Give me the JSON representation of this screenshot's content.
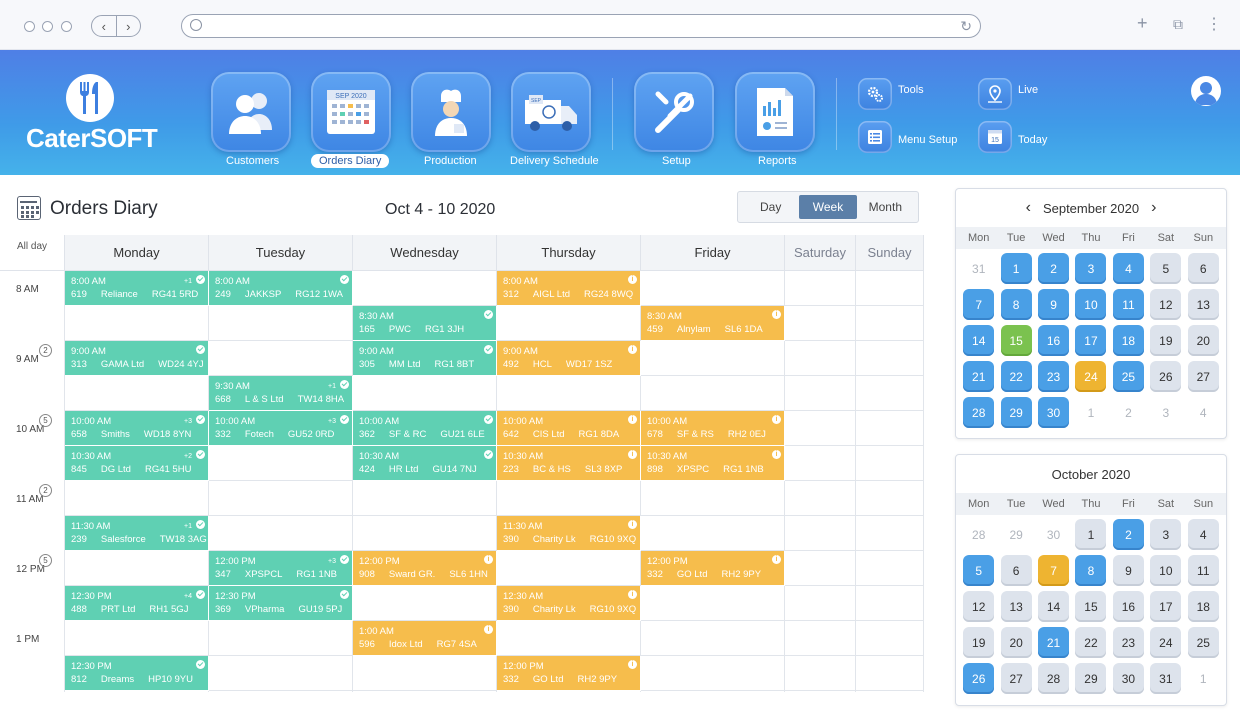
{
  "header": {
    "brand": "CaterSOFT",
    "nav": [
      {
        "label": "Customers",
        "icon": "customers-icon"
      },
      {
        "label": "Orders Diary",
        "icon": "calendar-icon",
        "icon_text": "SEP 2020",
        "active": true
      },
      {
        "label": "Production",
        "icon": "chef-icon"
      },
      {
        "label": "Delivery Schedule",
        "icon": "delivery-van-icon",
        "icon_text": "SEP"
      },
      {
        "label": "Setup",
        "icon": "tools-icon"
      },
      {
        "label": "Reports",
        "icon": "report-icon"
      }
    ],
    "quick": [
      {
        "label": "Tools",
        "icon": "gear-icon"
      },
      {
        "label": "Live",
        "icon": "map-pin-icon"
      },
      {
        "label": "Menu Setup",
        "icon": "list-icon"
      },
      {
        "label": "Today",
        "icon": "today-icon",
        "icon_text": "15"
      }
    ]
  },
  "toolbar": {
    "title": "Orders Diary",
    "range": "Oct 4 -  10 2020",
    "views": [
      "Day",
      "Week",
      "Month"
    ],
    "active_view": "Week"
  },
  "grid": {
    "allday": "All day",
    "days": [
      "Monday",
      "Tuesday",
      "Wednesday",
      "Thursday",
      "Friday",
      "Saturday",
      "Sunday"
    ],
    "times": [
      {
        "label": "8 AM",
        "row": 0
      },
      {
        "label": "9 AM",
        "row": 2,
        "count": "2"
      },
      {
        "label": "10 AM",
        "row": 4,
        "count": "5"
      },
      {
        "label": "11 AM",
        "row": 6,
        "count": "2"
      },
      {
        "label": "12 PM",
        "row": 8,
        "count": "5"
      },
      {
        "label": "1 PM",
        "row": 10
      }
    ],
    "events": [
      {
        "day": 0,
        "row": 0,
        "color": "green",
        "time": "8:00 AM",
        "id": "619",
        "name": "Reliance",
        "code": "RG41 5RD",
        "extra": "+1"
      },
      {
        "day": 1,
        "row": 0,
        "color": "green",
        "time": "8:00 AM",
        "id": "249",
        "name": "JAKKSP",
        "code": "RG12 1WA"
      },
      {
        "day": 3,
        "row": 0,
        "color": "orange",
        "time": "8:00 AM",
        "id": "312",
        "name": "AIGL Ltd",
        "code": "RG24 8WQ"
      },
      {
        "day": 2,
        "row": 1,
        "color": "green",
        "time": "8:30 AM",
        "id": "165",
        "name": "PWC",
        "code": "RG1 3JH"
      },
      {
        "day": 4,
        "row": 1,
        "color": "orange",
        "time": "8:30 AM",
        "id": "459",
        "name": "Alnylam",
        "code": "SL6 1DA"
      },
      {
        "day": 0,
        "row": 2,
        "color": "green",
        "time": "9:00 AM",
        "id": "313",
        "name": "GAMA Ltd",
        "code": "WD24 4YJ"
      },
      {
        "day": 2,
        "row": 2,
        "color": "green",
        "time": "9:00 AM",
        "id": "305",
        "name": "MM Ltd",
        "code": "RG1 8BT"
      },
      {
        "day": 3,
        "row": 2,
        "color": "orange",
        "time": "9:00 AM",
        "id": "492",
        "name": "HCL",
        "code": "WD17 1SZ"
      },
      {
        "day": 1,
        "row": 3,
        "color": "green",
        "time": "9:30 AM",
        "id": "668",
        "name": "L & S Ltd",
        "code": "TW14 8HA",
        "extra": "+1"
      },
      {
        "day": 0,
        "row": 4,
        "color": "green",
        "time": "10:00 AM",
        "id": "658",
        "name": "Smiths",
        "code": "WD18 8YN",
        "extra": "+3"
      },
      {
        "day": 1,
        "row": 4,
        "color": "green",
        "time": "10:00 AM",
        "id": "332",
        "name": "Fotech",
        "code": "GU52 0RD",
        "extra": "+3"
      },
      {
        "day": 2,
        "row": 4,
        "color": "green",
        "time": "10:00 AM",
        "id": "362",
        "name": "SF & RC",
        "code": "GU21 6LE"
      },
      {
        "day": 3,
        "row": 4,
        "color": "orange",
        "time": "10:00 AM",
        "id": "642",
        "name": "CIS Ltd",
        "code": "RG1 8DA"
      },
      {
        "day": 4,
        "row": 4,
        "color": "orange",
        "time": "10:00 AM",
        "id": "678",
        "name": "SF & RS",
        "code": "RH2 0EJ"
      },
      {
        "day": 0,
        "row": 5,
        "color": "green",
        "time": "10:30 AM",
        "id": "845",
        "name": "DG Ltd",
        "code": "RG41 5HU",
        "extra": "+2"
      },
      {
        "day": 2,
        "row": 5,
        "color": "green",
        "time": "10:30 AM",
        "id": "424",
        "name": "HR Ltd",
        "code": "GU14 7NJ"
      },
      {
        "day": 3,
        "row": 5,
        "color": "orange",
        "time": "10:30 AM",
        "id": "223",
        "name": "BC & HS",
        "code": "SL3 8XP"
      },
      {
        "day": 4,
        "row": 5,
        "color": "orange",
        "time": "10:30 AM",
        "id": "898",
        "name": "XPSPC",
        "code": "RG1 1NB"
      },
      {
        "day": 0,
        "row": 7,
        "color": "green",
        "time": "11:30 AM",
        "id": "239",
        "name": "Salesforce",
        "code": "TW18 3AG",
        "extra": "+1"
      },
      {
        "day": 3,
        "row": 7,
        "color": "orange",
        "time": "11:30 AM",
        "id": "390",
        "name": "Charity Lk",
        "code": "RG10 9XQ"
      },
      {
        "day": 1,
        "row": 8,
        "color": "green",
        "time": "12:00 PM",
        "id": "347",
        "name": "XPSPCL",
        "code": "RG1 1NB",
        "extra": "+3"
      },
      {
        "day": 2,
        "row": 8,
        "color": "orange",
        "time": "12:00 PM",
        "id": "908",
        "name": "Sward GR.",
        "code": "SL6 1HN"
      },
      {
        "day": 4,
        "row": 8,
        "color": "orange",
        "time": "12:00 PM",
        "id": "332",
        "name": "GO Ltd",
        "code": "RH2 9PY"
      },
      {
        "day": 0,
        "row": 9,
        "color": "green",
        "time": "12:30 PM",
        "id": "488",
        "name": "PRT Ltd",
        "code": "RH1 5GJ",
        "extra": "+4"
      },
      {
        "day": 1,
        "row": 9,
        "color": "green",
        "time": "12:30 PM",
        "id": "369",
        "name": "VPharma",
        "code": "GU19 5PJ"
      },
      {
        "day": 3,
        "row": 9,
        "color": "orange",
        "time": "12:30 AM",
        "id": "390",
        "name": "Charity Lk",
        "code": "RG10 9XQ"
      },
      {
        "day": 2,
        "row": 10,
        "color": "orange",
        "time": "1:00 AM",
        "id": "596",
        "name": "Idox Ltd",
        "code": "RG7 4SA"
      },
      {
        "day": 0,
        "row": 11,
        "color": "green",
        "time": "12:30 PM",
        "id": "812",
        "name": "Dreams",
        "code": "HP10 9YU"
      },
      {
        "day": 3,
        "row": 11,
        "color": "orange",
        "time": "12:00 PM",
        "id": "332",
        "name": "GO Ltd",
        "code": "RH2 9PY"
      }
    ]
  },
  "calendars": [
    {
      "title": "September 2020",
      "nav": true,
      "dow": [
        "Mon",
        "Tue",
        "Wed",
        "Thu",
        "Fri",
        "Sat",
        "Sun"
      ],
      "days": [
        [
          "31",
          "m"
        ],
        [
          "1",
          "b"
        ],
        [
          "2",
          "b"
        ],
        [
          "3",
          "b"
        ],
        [
          "4",
          "b"
        ],
        [
          "5",
          "n"
        ],
        [
          "6",
          "n"
        ],
        [
          "7",
          "b"
        ],
        [
          "8",
          "b"
        ],
        [
          "9",
          "b"
        ],
        [
          "10",
          "b"
        ],
        [
          "11",
          "b"
        ],
        [
          "12",
          "n"
        ],
        [
          "13",
          "n"
        ],
        [
          "14",
          "b"
        ],
        [
          "15",
          "gr"
        ],
        [
          "16",
          "b"
        ],
        [
          "17",
          "b"
        ],
        [
          "18",
          "b"
        ],
        [
          "19",
          "n"
        ],
        [
          "20",
          "n"
        ],
        [
          "21",
          "b"
        ],
        [
          "22",
          "b"
        ],
        [
          "23",
          "b"
        ],
        [
          "24",
          "yl"
        ],
        [
          "25",
          "b"
        ],
        [
          "26",
          "n"
        ],
        [
          "27",
          "n"
        ],
        [
          "28",
          "b"
        ],
        [
          "29",
          "b"
        ],
        [
          "30",
          "b"
        ],
        [
          "1",
          "m"
        ],
        [
          "2",
          "m"
        ],
        [
          "3",
          "m"
        ],
        [
          "4",
          "m"
        ]
      ]
    },
    {
      "title": "October 2020",
      "nav": false,
      "dow": [
        "Mon",
        "Tue",
        "Wed",
        "Thu",
        "Fri",
        "Sat",
        "Sun"
      ],
      "days": [
        [
          "28",
          "m"
        ],
        [
          "29",
          "m"
        ],
        [
          "30",
          "m"
        ],
        [
          "1",
          "n"
        ],
        [
          "2",
          "b"
        ],
        [
          "3",
          "n"
        ],
        [
          "4",
          "n"
        ],
        [
          "5",
          "b"
        ],
        [
          "6",
          "n"
        ],
        [
          "7",
          "yl"
        ],
        [
          "8",
          "b"
        ],
        [
          "9",
          "n"
        ],
        [
          "10",
          "n"
        ],
        [
          "11",
          "n"
        ],
        [
          "12",
          "n"
        ],
        [
          "13",
          "n"
        ],
        [
          "14",
          "n"
        ],
        [
          "15",
          "n"
        ],
        [
          "16",
          "n"
        ],
        [
          "17",
          "n"
        ],
        [
          "18",
          "n"
        ],
        [
          "19",
          "n"
        ],
        [
          "20",
          "n"
        ],
        [
          "21",
          "b"
        ],
        [
          "22",
          "n"
        ],
        [
          "23",
          "n"
        ],
        [
          "24",
          "n"
        ],
        [
          "25",
          "n"
        ],
        [
          "26",
          "b"
        ],
        [
          "27",
          "n"
        ],
        [
          "28",
          "n"
        ],
        [
          "29",
          "n"
        ],
        [
          "30",
          "n"
        ],
        [
          "31",
          "n"
        ],
        [
          "1",
          "m"
        ]
      ]
    }
  ],
  "colors": {
    "green": "#5fd0b3",
    "orange": "#f6bd4c",
    "header": "#3f9be8"
  }
}
